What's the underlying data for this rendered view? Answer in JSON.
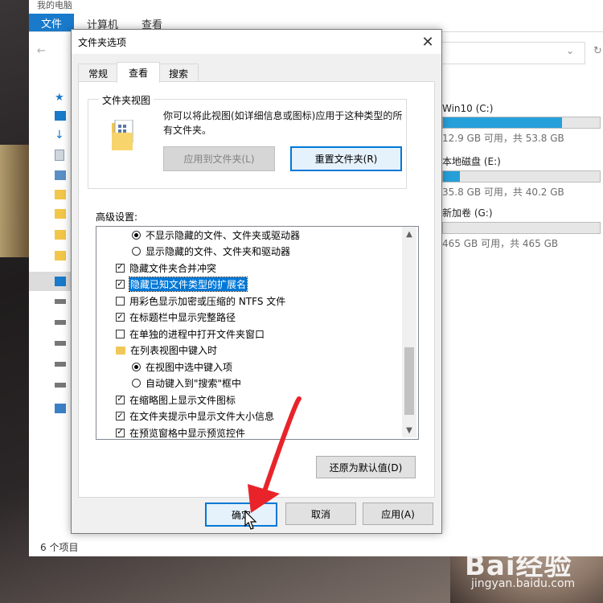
{
  "explorer": {
    "title_crumb": "我的电脑",
    "ribbon_tabs": [
      "文件",
      "计算机",
      "查看"
    ],
    "status_text": "6 个项目",
    "drives": [
      {
        "name": "Win10 (C:)",
        "info": "12.9 GB 可用，共 53.8 GB",
        "used_fraction": 0.76
      },
      {
        "name": "本地磁盘 (E:)",
        "info": "35.8 GB 可用，共 40.2 GB",
        "used_fraction": 0.11
      },
      {
        "name": "新加卷 (G:)",
        "info": "465 GB 可用，共 465 GB",
        "used_fraction": 0.0
      }
    ]
  },
  "dialog": {
    "title": "文件夹选项",
    "close_glyph": "✕",
    "tabs": [
      "常规",
      "查看",
      "搜索"
    ],
    "active_tab": "查看",
    "folder_views": {
      "group_title": "文件夹视图",
      "description": "你可以将此视图(如详细信息或图标)应用于这种类型的所有文件夹。",
      "apply_button": "应用到文件夹(L)",
      "reset_button": "重置文件夹(R)"
    },
    "advanced_label": "高级设置:",
    "advanced_items": [
      {
        "type": "radio",
        "checked": true,
        "label": "不显示隐藏的文件、文件夹或驱动器",
        "indent": 1
      },
      {
        "type": "radio",
        "checked": false,
        "label": "显示隐藏的文件、文件夹和驱动器",
        "indent": 1
      },
      {
        "type": "checkbox",
        "checked": true,
        "label": "隐藏文件夹合并冲突",
        "indent": 0
      },
      {
        "type": "checkbox",
        "checked": true,
        "label": "隐藏已知文件类型的扩展名",
        "indent": 0,
        "highlighted": true
      },
      {
        "type": "checkbox",
        "checked": false,
        "label": "用彩色显示加密或压缩的 NTFS 文件",
        "indent": 0
      },
      {
        "type": "checkbox",
        "checked": true,
        "label": "在标题栏中显示完整路径",
        "indent": 0
      },
      {
        "type": "checkbox",
        "checked": false,
        "label": "在单独的进程中打开文件夹窗口",
        "indent": 0
      },
      {
        "type": "folder",
        "label": "在列表视图中键入时",
        "indent": 0
      },
      {
        "type": "radio",
        "checked": true,
        "label": "在视图中选中键入项",
        "indent": 1
      },
      {
        "type": "radio",
        "checked": false,
        "label": "自动键入到\"搜索\"框中",
        "indent": 1
      },
      {
        "type": "checkbox",
        "checked": true,
        "label": "在缩略图上显示文件图标",
        "indent": 0
      },
      {
        "type": "checkbox",
        "checked": true,
        "label": "在文件夹提示中显示文件大小信息",
        "indent": 0
      },
      {
        "type": "checkbox",
        "checked": true,
        "label": "在预览窗格中显示预览控件",
        "indent": 0
      }
    ],
    "restore_defaults_button": "还原为默认值(D)",
    "ok_button": "确定",
    "cancel_button": "取消",
    "apply_button": "应用(A)"
  },
  "watermark": {
    "brand": "Bai经验",
    "url": "jingyan.baidu.com"
  },
  "colors": {
    "accent": "#0078d7",
    "ribbon_file": "#1979ca",
    "drive_bar": "#26a0da",
    "arrow": "#e8242a"
  }
}
